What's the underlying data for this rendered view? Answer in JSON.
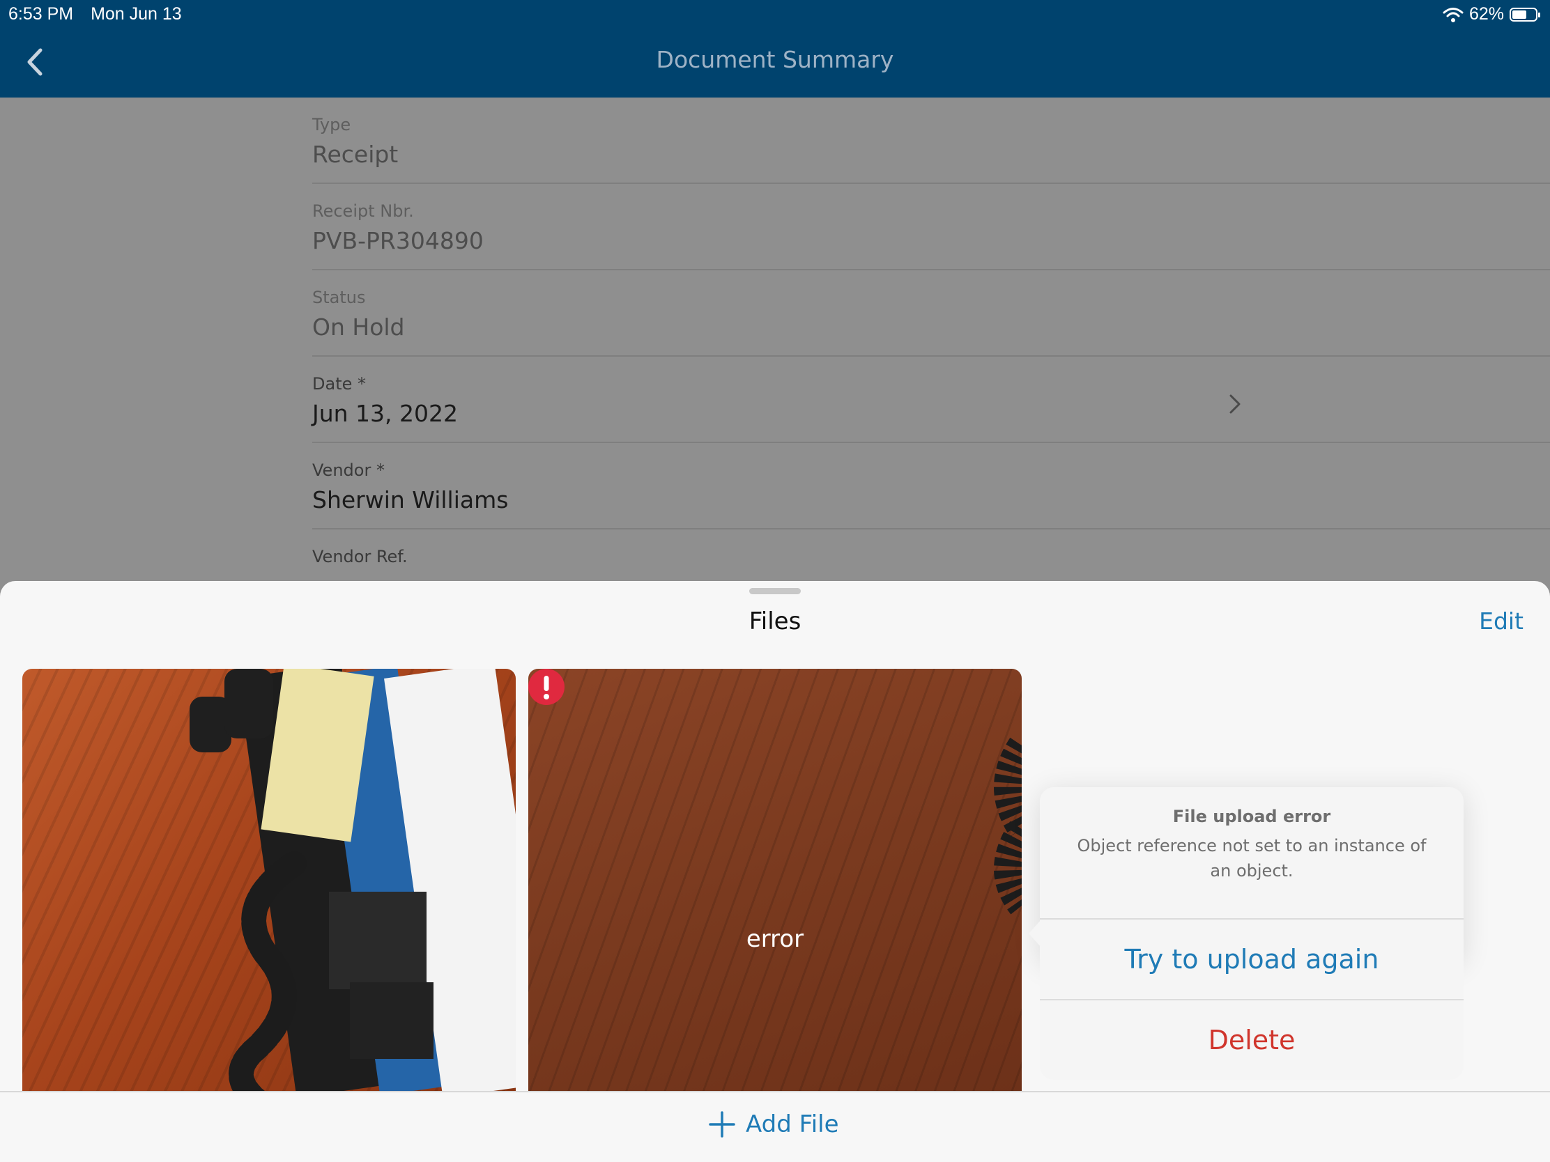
{
  "status_bar": {
    "time": "6:53 PM",
    "date": "Mon Jun 13",
    "battery": "62%",
    "battery_level": 0.62
  },
  "header": {
    "title": "Document Summary",
    "back_icon": "chevron-left-icon"
  },
  "form": {
    "fields": [
      {
        "label": "Type",
        "value": "Receipt"
      },
      {
        "label": "Receipt Nbr.",
        "value": "PVB-PR304890"
      },
      {
        "label": "Status",
        "value": "On Hold"
      },
      {
        "label": "Date *",
        "value": "Jun 13, 2022"
      },
      {
        "label": "Vendor *",
        "value": "Sherwin Williams"
      },
      {
        "label": "Vendor Ref.",
        "value": ""
      }
    ]
  },
  "files_sheet": {
    "title": "Files",
    "edit_label": "Edit",
    "thumbnails": [
      {
        "status": ""
      },
      {
        "status": "error"
      }
    ],
    "add_file_label": "Add File"
  },
  "popover": {
    "title": "File upload error",
    "message": "Object reference not set to an instance of an object.",
    "retry_label": "Try to upload again",
    "delete_label": "Delete"
  },
  "colors": {
    "header_bg": "#00436e",
    "accent": "#1f7bb6",
    "destructive": "#d0352c",
    "error_badge": "#e0293f"
  }
}
